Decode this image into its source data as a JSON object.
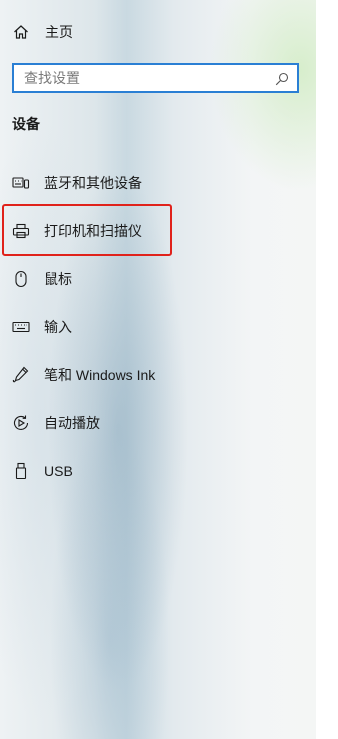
{
  "home": {
    "label": "主页",
    "icon": "home-icon"
  },
  "search": {
    "placeholder": "查找设置",
    "value": "",
    "icon": "search-icon",
    "border_color": "#2a7fd4"
  },
  "section": {
    "title": "设备"
  },
  "nav": {
    "items": [
      {
        "label": "蓝牙和其他设备",
        "icon": "bluetooth-devices-icon"
      },
      {
        "label": "打印机和扫描仪",
        "icon": "printer-icon"
      },
      {
        "label": "鼠标",
        "icon": "mouse-icon"
      },
      {
        "label": "输入",
        "icon": "keyboard-icon"
      },
      {
        "label": "笔和 Windows Ink",
        "icon": "pen-icon"
      },
      {
        "label": "自动播放",
        "icon": "autoplay-icon"
      },
      {
        "label": "USB",
        "icon": "usb-icon"
      }
    ]
  },
  "highlight": {
    "color": "#e0221b"
  }
}
